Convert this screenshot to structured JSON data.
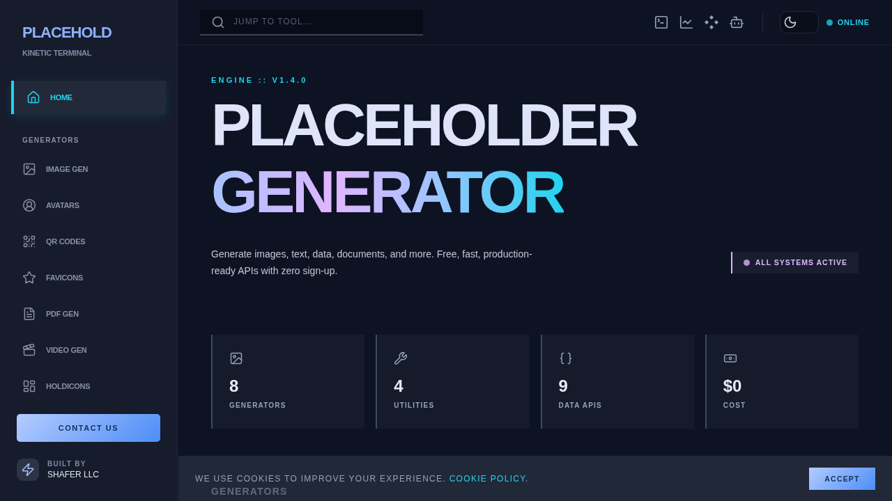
{
  "sidebar": {
    "brand": "PLACEHOLD",
    "tagline": "KINETIC TERMINAL",
    "items": [
      {
        "label": "HOME",
        "selected": true
      }
    ],
    "section": "GENERATORS",
    "generators": [
      {
        "label": "IMAGE GEN",
        "selected": false
      },
      {
        "label": "AVATARS",
        "selected": false
      },
      {
        "label": "QR CODES",
        "selected": false
      },
      {
        "label": "FAVICONS",
        "selected": false
      },
      {
        "label": "PDF GEN",
        "selected": false
      },
      {
        "label": "VIDEO GEN",
        "selected": false
      },
      {
        "label": "HOLDICONS",
        "selected": false
      }
    ],
    "contact_button": "CONTACT US",
    "built_by": {
      "label": "BUILT BY",
      "name": "SHAFER LLC"
    }
  },
  "topbar": {
    "search": {
      "placeholder": "JUMP TO TOOL..."
    },
    "theme_toggle": {
      "on": true
    },
    "status": "ONLINE"
  },
  "hero": {
    "eyebrow": "ENGINE :: V1.4.0",
    "title_line1": "PLACEHOLDER",
    "title_line2": "GENERATOR",
    "description": "Generate images, text, data, documents, and more. Free, fast, production-ready APIs with zero sign-up.",
    "badge": "ALL SYSTEMS ACTIVE"
  },
  "stats": [
    {
      "value": "8",
      "label": "GENERATORS"
    },
    {
      "value": "4",
      "label": "UTILITIES"
    },
    {
      "value": "9",
      "label": "DATA APIS"
    },
    {
      "value": "$0",
      "label": "COST"
    }
  ],
  "next_section": "GENERATORS",
  "cookie_banner": {
    "text": "WE USE COOKIES TO IMPROVE YOUR EXPERIENCE.",
    "link": "COOKIE POLICY",
    "after": ".",
    "button": "ACCEPT"
  }
}
